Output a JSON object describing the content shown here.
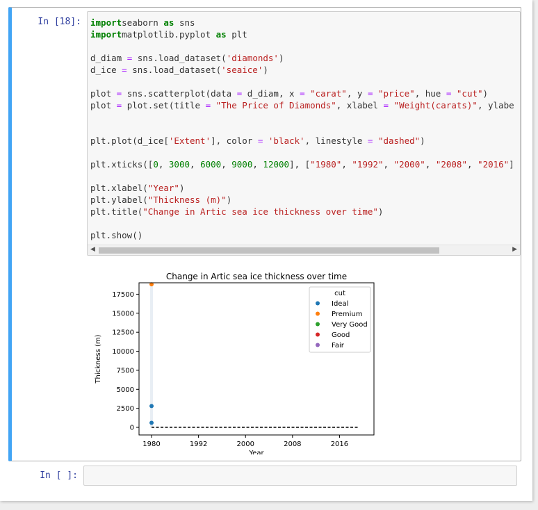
{
  "cell1": {
    "prompt": "In [18]:",
    "code": [
      [
        [
          "kw",
          "import"
        ],
        [
          "",
          "seaborn "
        ],
        [
          "kw",
          "as"
        ],
        [
          "",
          " sns"
        ]
      ],
      [
        [
          "kw",
          "import"
        ],
        [
          "",
          "matplotlib.pyplot "
        ],
        [
          "kw",
          "as"
        ],
        [
          "",
          " plt"
        ]
      ],
      [],
      [
        [
          "",
          "d_diam "
        ],
        [
          "op",
          "="
        ],
        [
          "",
          " sns.load_dataset("
        ],
        [
          "str",
          "'diamonds'"
        ],
        [
          "",
          ")"
        ]
      ],
      [
        [
          "",
          "d_ice "
        ],
        [
          "op",
          "="
        ],
        [
          "",
          " sns.load_dataset("
        ],
        [
          "str",
          "'seaice'"
        ],
        [
          "",
          ")"
        ]
      ],
      [],
      [
        [
          "",
          "plot "
        ],
        [
          "op",
          "="
        ],
        [
          "",
          " sns.scatterplot(data "
        ],
        [
          "op",
          "="
        ],
        [
          "",
          " d_diam, x "
        ],
        [
          "op",
          "="
        ],
        [
          "",
          ""
        ],
        [
          "str",
          " \"carat\""
        ],
        [
          "",
          ", y "
        ],
        [
          "op",
          "="
        ],
        [
          "str",
          " \"price\""
        ],
        [
          "",
          ", hue "
        ],
        [
          "op",
          "="
        ],
        [
          "str",
          " \"cut\""
        ],
        [
          "",
          ")"
        ]
      ],
      [
        [
          "",
          "plot "
        ],
        [
          "op",
          "="
        ],
        [
          "",
          " plot.set(title "
        ],
        [
          "op",
          "="
        ],
        [
          "str",
          " \"The Price of Diamonds\""
        ],
        [
          "",
          ", xlabel "
        ],
        [
          "op",
          "="
        ],
        [
          "str",
          " \"Weight(carats)\""
        ],
        [
          "",
          ", ylabe"
        ]
      ],
      [],
      [],
      [
        [
          "",
          "plt.plot(d_ice["
        ],
        [
          "str",
          "'Extent'"
        ],
        [
          "",
          "], color "
        ],
        [
          "op",
          "="
        ],
        [
          "str",
          " 'black'"
        ],
        [
          "",
          ", linestyle "
        ],
        [
          "op",
          "="
        ],
        [
          "str",
          " \"dashed\""
        ],
        [
          "",
          ")"
        ]
      ],
      [],
      [
        [
          "",
          "plt.xticks(["
        ],
        [
          "num",
          "0"
        ],
        [
          "",
          ", "
        ],
        [
          "num",
          "3000"
        ],
        [
          "",
          ", "
        ],
        [
          "num",
          "6000"
        ],
        [
          "",
          ", "
        ],
        [
          "num",
          "9000"
        ],
        [
          "",
          ", "
        ],
        [
          "num",
          "12000"
        ],
        [
          "",
          "], ["
        ],
        [
          "str",
          "\"1980\""
        ],
        [
          "",
          ", "
        ],
        [
          "str",
          "\"1992\""
        ],
        [
          "",
          ", "
        ],
        [
          "str",
          "\"2000\""
        ],
        [
          "",
          ", "
        ],
        [
          "str",
          "\"2008\""
        ],
        [
          "",
          ", "
        ],
        [
          "str",
          "\"2016\""
        ],
        [
          "",
          "]"
        ]
      ],
      [],
      [
        [
          "",
          "plt.xlabel("
        ],
        [
          "str",
          "\"Year\""
        ],
        [
          "",
          ")"
        ]
      ],
      [
        [
          "",
          "plt.ylabel("
        ],
        [
          "str",
          "\"Thickness (m)\""
        ],
        [
          "",
          ")"
        ]
      ],
      [
        [
          "",
          "plt.title("
        ],
        [
          "str",
          "\"Change in Artic sea ice thickness over time\""
        ],
        [
          "",
          ")"
        ]
      ],
      [],
      [
        [
          "",
          "plt.show()"
        ]
      ]
    ]
  },
  "cell2": {
    "prompt": "In [ ]:"
  },
  "chart_data": {
    "type": "scatter",
    "title": "Change in Artic sea ice thickness over time",
    "xlabel": "Year",
    "ylabel": "Thickness (m)",
    "x_ticks": [
      0,
      3000,
      6000,
      9000,
      12000
    ],
    "x_tick_labels": [
      "1980",
      "1992",
      "2000",
      "2008",
      "2016"
    ],
    "y_ticks": [
      0,
      2500,
      5000,
      7500,
      10000,
      12500,
      15000,
      17500
    ],
    "y_tick_labels": [
      "0",
      "2500",
      "5000",
      "7500",
      "10000",
      "12500",
      "15000",
      "17500"
    ],
    "xlim": [
      -800,
      14200
    ],
    "ylim": [
      -1000,
      19000
    ],
    "legend": {
      "title": "cut",
      "placement": "top-right",
      "entries": [
        {
          "label": "Ideal",
          "color": "#1f77b4"
        },
        {
          "label": "Premium",
          "color": "#ff7f0e"
        },
        {
          "label": "Very Good",
          "color": "#2ca02c"
        },
        {
          "label": "Good",
          "color": "#d62728"
        },
        {
          "label": "Fair",
          "color": "#9467bd"
        }
      ]
    },
    "series": [
      {
        "name": "Ideal",
        "color": "#1f77b4",
        "points": [
          [
            0,
            2800
          ],
          [
            0,
            600
          ]
        ]
      },
      {
        "name": "Premium",
        "color": "#ff7f0e",
        "points": [
          [
            0,
            18800
          ]
        ]
      }
    ],
    "line": {
      "color": "black",
      "linestyle": "dashed",
      "x": [
        0,
        13200
      ],
      "y": [
        0,
        0
      ]
    },
    "grid": false
  }
}
